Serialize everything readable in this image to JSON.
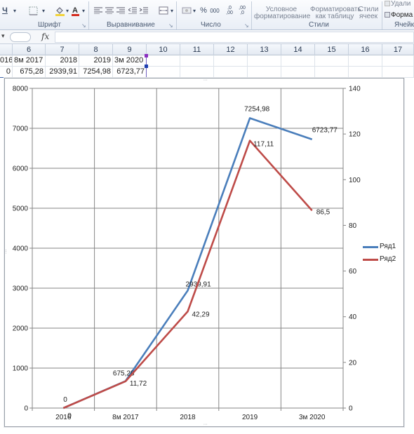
{
  "ribbon": {
    "groups": {
      "font": "Шрифт",
      "alignment": "Выравнивание",
      "number": "Число",
      "styles": "Стили",
      "cells": "Ячейк"
    },
    "number_format": {
      "percent": "%",
      "thousands": "000",
      "increase_decimals": ",0 ,00",
      "decrease_decimals": ",00 ,0"
    },
    "styles_buttons": {
      "conditional_line1": "Условное",
      "conditional_line2": "форматирование",
      "table_line1": "Форматировать",
      "table_line2": "как таблицу",
      "cellstyles_line1": "Стили",
      "cellstyles_line2": "ячеек"
    },
    "cells_buttons": {
      "delete": "Удали",
      "format": "Форма"
    }
  },
  "formula_bar": {
    "fx": "fx",
    "value": ""
  },
  "columns": [
    "6",
    "7",
    "8",
    "9",
    "10",
    "11",
    "12",
    "13",
    "14",
    "15",
    "16",
    "17"
  ],
  "rows": [
    [
      "016",
      "8м 2017",
      "2018",
      "2019",
      "3м 2020"
    ],
    [
      "0",
      "675,28",
      "2939,91",
      "7254,98",
      "6723,77"
    ]
  ],
  "chart_data": {
    "type": "line",
    "categories": [
      "2016",
      "8м 2017",
      "2018",
      "2019",
      "3м 2020"
    ],
    "series": [
      {
        "name": "Ряд1",
        "values": [
          0,
          675.28,
          2939.91,
          7254.98,
          6723.77
        ],
        "labels": [
          "0",
          "675,28",
          "2939,91",
          "7254,98",
          "6723,77"
        ],
        "axis": "primary",
        "color": "#4a7ebb"
      },
      {
        "name": "Ряд2",
        "values": [
          0,
          11.72,
          42.29,
          117.11,
          86.5
        ],
        "labels": [
          "0",
          "11,72",
          "42,29",
          "117,11",
          "86,5"
        ],
        "axis": "secondary",
        "color": "#be4b48"
      }
    ],
    "y_ticks": [
      "0",
      "1000",
      "2000",
      "3000",
      "4000",
      "5000",
      "6000",
      "7000",
      "8000"
    ],
    "y2_ticks": [
      "0",
      "20",
      "40",
      "60",
      "80",
      "100",
      "120",
      "140"
    ],
    "ylim": [
      0,
      8000
    ],
    "y2lim": [
      0,
      140
    ],
    "grid": true,
    "legend_position": "right"
  }
}
